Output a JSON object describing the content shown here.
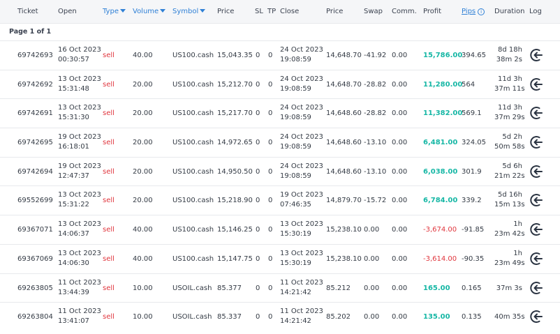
{
  "columns": {
    "ticket": "Ticket",
    "open": "Open",
    "type": "Type",
    "volume": "Volume",
    "symbol": "Symbol",
    "price": "Price",
    "sl": "SL",
    "tp": "TP",
    "close": "Close",
    "close_price": "Price",
    "swap": "Swap",
    "comm": "Comm.",
    "profit": "Profit",
    "pips": "Pips",
    "duration": "Duration",
    "log": "Log"
  },
  "page_label": "Page 1 of 1",
  "icons": {
    "sort": "caret-down-icon",
    "info": "info-icon",
    "log": "log-return-icon"
  },
  "colors": {
    "sell": "#e0353d",
    "profit_positive": "#16b7a5",
    "profit_negative": "#e0353d",
    "link": "#2f80d6"
  },
  "rows": [
    {
      "ticket": "69742693",
      "open_date": "16 Oct 2023",
      "open_time": "00:30:57",
      "type": "sell",
      "volume": "40.00",
      "symbol": "US100.cash",
      "price": "15,043.35",
      "sl": "0",
      "tp": "0",
      "close_date": "24 Oct 2023",
      "close_time": "19:08:59",
      "close_price": "14,648.70",
      "swap": "-41.92",
      "comm": "0.00",
      "profit": "15,786.00",
      "profit_sign": "pos",
      "pips": "394.65",
      "duration_1": "8d 18h",
      "duration_2": "38m 2s"
    },
    {
      "ticket": "69742692",
      "open_date": "13 Oct 2023",
      "open_time": "15:31:48",
      "type": "sell",
      "volume": "20.00",
      "symbol": "US100.cash",
      "price": "15,212.70",
      "sl": "0",
      "tp": "0",
      "close_date": "24 Oct 2023",
      "close_time": "19:08:59",
      "close_price": "14,648.70",
      "swap": "-28.82",
      "comm": "0.00",
      "profit": "11,280.00",
      "profit_sign": "pos",
      "pips": "564",
      "duration_1": "11d 3h",
      "duration_2": "37m 11s"
    },
    {
      "ticket": "69742691",
      "open_date": "13 Oct 2023",
      "open_time": "15:31:30",
      "type": "sell",
      "volume": "20.00",
      "symbol": "US100.cash",
      "price": "15,217.70",
      "sl": "0",
      "tp": "0",
      "close_date": "24 Oct 2023",
      "close_time": "19:08:59",
      "close_price": "14,648.60",
      "swap": "-28.82",
      "comm": "0.00",
      "profit": "11,382.00",
      "profit_sign": "pos",
      "pips": "569.1",
      "duration_1": "11d 3h",
      "duration_2": "37m 29s"
    },
    {
      "ticket": "69742695",
      "open_date": "19 Oct 2023",
      "open_time": "16:18:01",
      "type": "sell",
      "volume": "20.00",
      "symbol": "US100.cash",
      "price": "14,972.65",
      "sl": "0",
      "tp": "0",
      "close_date": "24 Oct 2023",
      "close_time": "19:08:59",
      "close_price": "14,648.60",
      "swap": "-13.10",
      "comm": "0.00",
      "profit": "6,481.00",
      "profit_sign": "pos",
      "pips": "324.05",
      "duration_1": "5d 2h",
      "duration_2": "50m 58s"
    },
    {
      "ticket": "69742694",
      "open_date": "19 Oct 2023",
      "open_time": "12:47:37",
      "type": "sell",
      "volume": "20.00",
      "symbol": "US100.cash",
      "price": "14,950.50",
      "sl": "0",
      "tp": "0",
      "close_date": "24 Oct 2023",
      "close_time": "19:08:59",
      "close_price": "14,648.60",
      "swap": "-13.10",
      "comm": "0.00",
      "profit": "6,038.00",
      "profit_sign": "pos",
      "pips": "301.9",
      "duration_1": "5d 6h",
      "duration_2": "21m 22s"
    },
    {
      "ticket": "69552699",
      "open_date": "13 Oct 2023",
      "open_time": "15:31:22",
      "type": "sell",
      "volume": "20.00",
      "symbol": "US100.cash",
      "price": "15,218.90",
      "sl": "0",
      "tp": "0",
      "close_date": "19 Oct 2023",
      "close_time": "07:46:35",
      "close_price": "14,879.70",
      "swap": "-15.72",
      "comm": "0.00",
      "profit": "6,784.00",
      "profit_sign": "pos",
      "pips": "339.2",
      "duration_1": "5d 16h",
      "duration_2": "15m 13s"
    },
    {
      "ticket": "69367071",
      "open_date": "13 Oct 2023",
      "open_time": "14:06:37",
      "type": "sell",
      "volume": "40.00",
      "symbol": "US100.cash",
      "price": "15,146.25",
      "sl": "0",
      "tp": "0",
      "close_date": "13 Oct 2023",
      "close_time": "15:30:19",
      "close_price": "15,238.10",
      "swap": "0.00",
      "comm": "0.00",
      "profit": "-3,674.00",
      "profit_sign": "neg",
      "pips": "-91.85",
      "duration_1": "1h",
      "duration_2": "23m 42s"
    },
    {
      "ticket": "69367069",
      "open_date": "13 Oct 2023",
      "open_time": "14:06:30",
      "type": "sell",
      "volume": "40.00",
      "symbol": "US100.cash",
      "price": "15,147.75",
      "sl": "0",
      "tp": "0",
      "close_date": "13 Oct 2023",
      "close_time": "15:30:19",
      "close_price": "15,238.10",
      "swap": "0.00",
      "comm": "0.00",
      "profit": "-3,614.00",
      "profit_sign": "neg",
      "pips": "-90.35",
      "duration_1": "1h",
      "duration_2": "23m 49s"
    },
    {
      "ticket": "69263805",
      "open_date": "11 Oct 2023",
      "open_time": "13:44:39",
      "type": "sell",
      "volume": "10.00",
      "symbol": "USOIL.cash",
      "price": "85.377",
      "sl": "0",
      "tp": "0",
      "close_date": "11 Oct 2023",
      "close_time": "14:21:42",
      "close_price": "85.212",
      "swap": "0.00",
      "comm": "0.00",
      "profit": "165.00",
      "profit_sign": "pos",
      "pips": "0.165",
      "duration_1": "37m 3s",
      "duration_2": ""
    },
    {
      "ticket": "69263804",
      "open_date": "11 Oct 2023",
      "open_time": "13:41:07",
      "type": "sell",
      "volume": "10.00",
      "symbol": "USOIL.cash",
      "price": "85.337",
      "sl": "0",
      "tp": "0",
      "close_date": "11 Oct 2023",
      "close_time": "14:21:42",
      "close_price": "85.202",
      "swap": "0.00",
      "comm": "0.00",
      "profit": "135.00",
      "profit_sign": "pos",
      "pips": "0.135",
      "duration_1": "40m 35s",
      "duration_2": ""
    }
  ]
}
